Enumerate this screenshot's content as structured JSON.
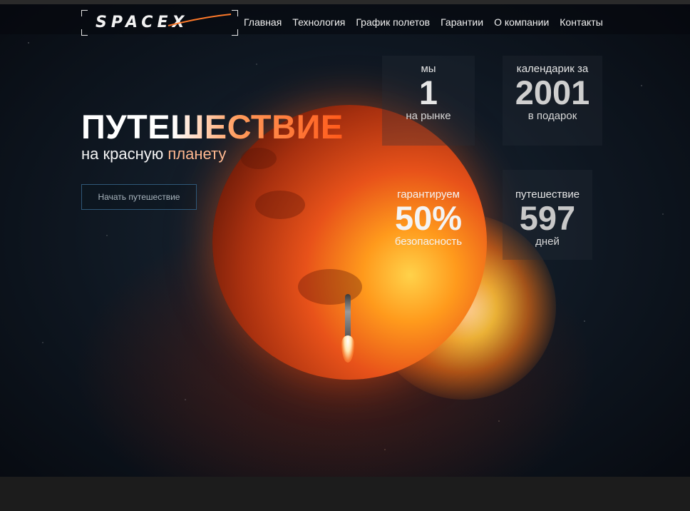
{
  "header": {
    "logo_text": "SPACEX",
    "nav": [
      "Главная",
      "Технология",
      "График полетов",
      "Гарантии",
      "О компании",
      "Контакты"
    ]
  },
  "hero": {
    "title": "ПУТЕШЕСТВИЕ",
    "subtitle_part1": "на красную ",
    "subtitle_part2": "планету",
    "cta_label": "Начать путешествие"
  },
  "stats": [
    {
      "top": "мы",
      "value": "1",
      "bottom": "на рынке"
    },
    {
      "top": "календарик за",
      "value": "2001",
      "bottom": "в подарок"
    },
    {
      "top": "гарантируем",
      "value": "50%",
      "bottom": "безопасность"
    },
    {
      "top": "путешествие",
      "value": "597",
      "bottom": "дней"
    }
  ],
  "colors": {
    "accent_orange": "#ff5a1a",
    "cta_border": "#2f5878",
    "background_dark": "#1c1c1c"
  },
  "icons": {
    "logo": "spacex-logo",
    "illustration": "mars-planet-with-rocket"
  }
}
